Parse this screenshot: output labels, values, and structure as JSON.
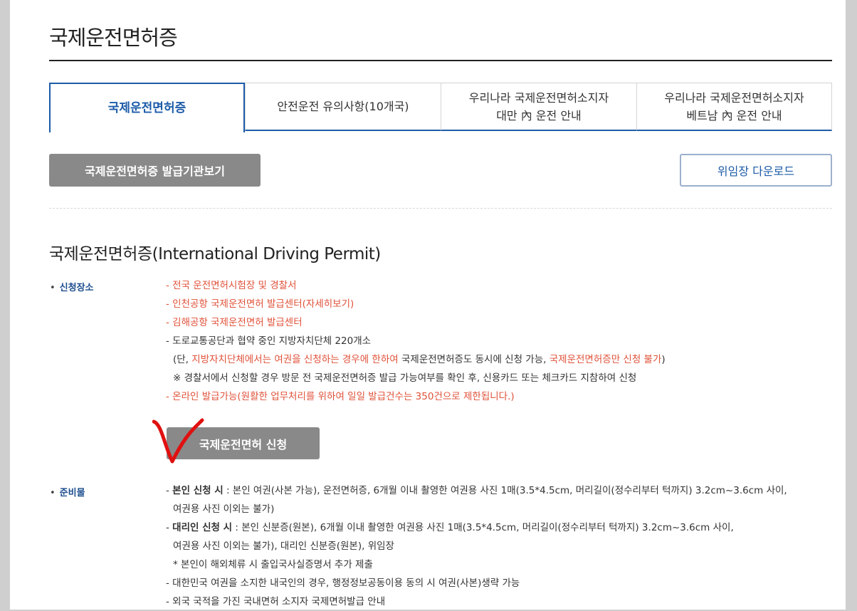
{
  "page_title": "국제운전면허증",
  "tabs": [
    {
      "line1": "국제운전면허증",
      "line2": ""
    },
    {
      "line1": "안전운전 유의사항(10개국)",
      "line2": ""
    },
    {
      "line1": "우리나라 국제운전면허소지자",
      "line2": "대만 內 운전 안내"
    },
    {
      "line1": "우리나라 국제운전면허소지자",
      "line2": "베트남 內 운전 안내"
    }
  ],
  "buttons": {
    "issuers": "국제운전면허증 발급기관보기",
    "download": "위임장 다운로드",
    "apply": "국제운전면허 신청"
  },
  "section_title": "국제운전면허증(International Driving Permit)",
  "apply_place": {
    "label": "신청장소",
    "l1": "- 전국 운전면허시험장 및 경찰서",
    "l2": "- 인천공항 국제운전면허 발급센터(자세히보기)",
    "l3": "- 김해공항 국제운전면허 발급센터",
    "l4": "- 도로교통공단과 협약 중인 지방자치단체 220개소",
    "l5a": "(단, ",
    "l5b": "지방자치단체에서는 여권을 신청하는 경우에 한하여",
    "l5c": " 국제운전면허증도 동시에 신청 가능, ",
    "l5d": "국제운전면허증만 신청 불가",
    "l5e": ")",
    "l6": "※ 경찰서에서 신청할 경우 방문 전 국제운전면허증 발급 가능여부를 확인 후, 신용카드 또는 체크카드 지참하여 신청",
    "l7": "- 온라인 발급가능(원활한 업무처리를 위하여 일일 발급건수는 350건으로 제한됩니다.)"
  },
  "prep": {
    "label": "준비물",
    "p1_dash": "- ",
    "p1_bold": "본인 신청 시",
    "p1_rest": " : 본인 여권(사본 가능), 운전면허증, 6개월 이내 촬영한 여권용 사진 1매(3.5*4.5cm, 머리길이(정수리부터 턱까지) 3.2cm~3.6cm 사이,",
    "p2": "여권용 사진 이외는 불가)",
    "p3_dash": "- ",
    "p3_bold": "대리인 신청 시",
    "p3_rest": " : 본인 신분증(원본), 6개월 이내 촬영한 여권용 사진 1매(3.5*4.5cm, 머리길이(정수리부터 턱까지) 3.2cm~3.6cm 사이,",
    "p4": "여권용 사진 이외는 불가), 대리인 신분증(원본), 위임장",
    "p5": "* 본인이 해외체류 시 출입국사실증명서 추가 제출",
    "p6": "- 대한민국 여권을 소지한 내국인의 경우, 행정정보공동이용 동의 시 여권(사본)생략 가능",
    "p7": "- 외국 국적을 가진 국내면허 소지자 국제면허발급 안내"
  },
  "colors": {
    "accent": "#1d5ca8",
    "red": "#e0523a",
    "button_gray": "#898989",
    "check_mark": "#e01010"
  }
}
